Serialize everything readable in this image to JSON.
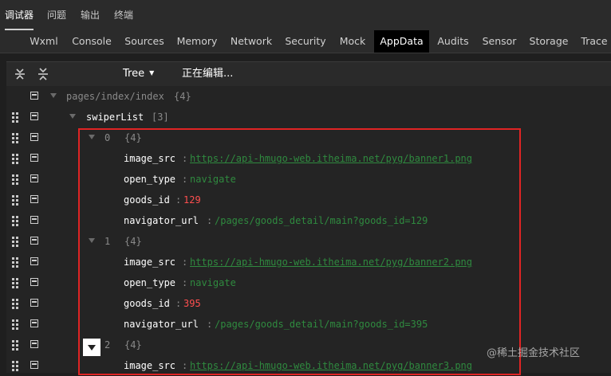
{
  "top_tabs": [
    {
      "label": "调试器",
      "active": true
    },
    {
      "label": "问题",
      "active": false
    },
    {
      "label": "输出",
      "active": false
    },
    {
      "label": "终端",
      "active": false
    }
  ],
  "dev_tabs": [
    {
      "label": "Wxml",
      "active": false
    },
    {
      "label": "Console",
      "active": false
    },
    {
      "label": "Sources",
      "active": false
    },
    {
      "label": "Memory",
      "active": false
    },
    {
      "label": "Network",
      "active": false
    },
    {
      "label": "Security",
      "active": false
    },
    {
      "label": "Mock",
      "active": false
    },
    {
      "label": "AppData",
      "active": true
    },
    {
      "label": "Audits",
      "active": false
    },
    {
      "label": "Sensor",
      "active": false
    },
    {
      "label": "Storage",
      "active": false
    },
    {
      "label": "Trace",
      "active": false
    }
  ],
  "toolbar": {
    "view_mode": "Tree",
    "status": "正在编辑..."
  },
  "tree": {
    "root": {
      "path": "pages/index/index",
      "count": "{4}"
    },
    "list": {
      "name": "swiperList",
      "count": "[3]"
    },
    "items": [
      {
        "index": "0",
        "count": "{4}",
        "fields": [
          {
            "key": "image_src",
            "value": "https://api-hmugo-web.itheima.net/pyg/banner1.png",
            "kind": "link"
          },
          {
            "key": "open_type",
            "value": "navigate",
            "kind": "str"
          },
          {
            "key": "goods_id",
            "value": "129",
            "kind": "num"
          },
          {
            "key": "navigator_url",
            "value": "/pages/goods_detail/main?goods_id=129",
            "kind": "str"
          }
        ]
      },
      {
        "index": "1",
        "count": "{4}",
        "fields": [
          {
            "key": "image_src",
            "value": "https://api-hmugo-web.itheima.net/pyg/banner2.png",
            "kind": "link"
          },
          {
            "key": "open_type",
            "value": "navigate",
            "kind": "str"
          },
          {
            "key": "goods_id",
            "value": "395",
            "kind": "num"
          },
          {
            "key": "navigator_url",
            "value": "/pages/goods_detail/main?goods_id=395",
            "kind": "str"
          }
        ]
      },
      {
        "index": "2",
        "count": "{4}",
        "fields": [
          {
            "key": "image_src",
            "value": "https://api-hmugo-web.itheima.net/pyg/banner3.png",
            "kind": "link"
          }
        ]
      }
    ],
    "colon": ":"
  },
  "watermark": "@稀土掘金技术社区"
}
